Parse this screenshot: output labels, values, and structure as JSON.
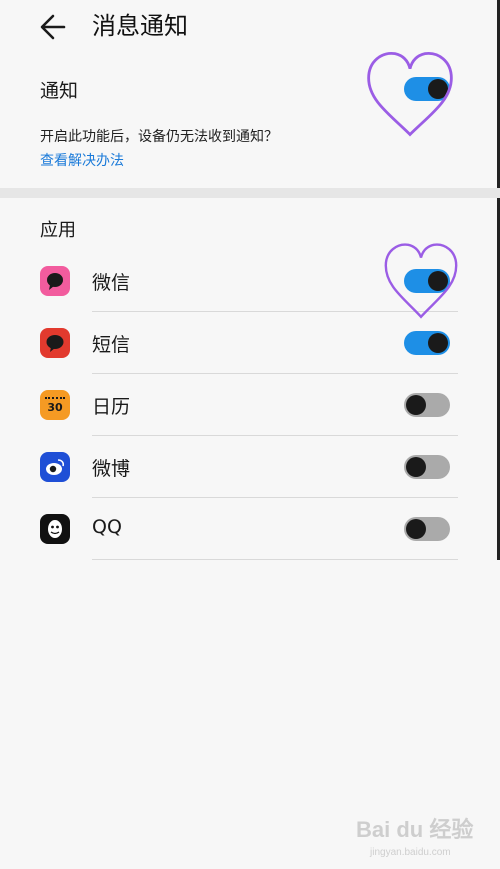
{
  "header": {
    "title": "消息通知",
    "back_icon": "arrow-left-icon"
  },
  "notify": {
    "label": "通知",
    "enabled": true,
    "hint": "开启此功能后，设备仍无法收到通知？",
    "help_link": "查看解决办法"
  },
  "apps_section": {
    "label": "应用",
    "items": [
      {
        "name": "微信",
        "icon": "wechat-icon",
        "enabled": true
      },
      {
        "name": "短信",
        "icon": "sms-icon",
        "enabled": true
      },
      {
        "name": "日历",
        "icon": "calendar-icon",
        "enabled": false,
        "icon_text": "30"
      },
      {
        "name": "微博",
        "icon": "weibo-icon",
        "enabled": false
      },
      {
        "name": "QQ",
        "icon": "qq-icon",
        "enabled": false
      }
    ]
  },
  "annotations": {
    "heart_color": "#9b5de5",
    "heart_icon": "heart-outline-icon"
  },
  "colors": {
    "toggle_on": "#1e8fe6",
    "toggle_off": "#aaaaaa",
    "link": "#1a7ad9",
    "background": "#f7f7f7"
  },
  "watermark": {
    "text": "Bai du 经验",
    "subtext": "jingyan.baidu.com"
  }
}
